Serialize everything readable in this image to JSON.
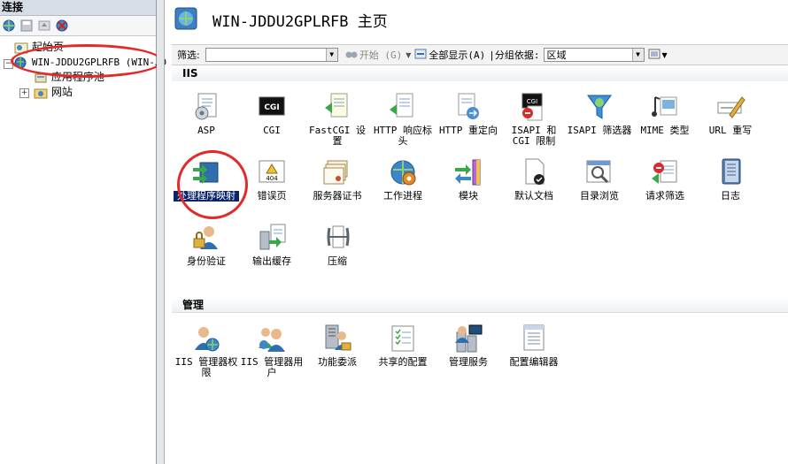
{
  "left_panel": {
    "title": "连接",
    "tree": [
      {
        "label": "起始页"
      },
      {
        "label": "WIN-JDDU2GPLRFB (WIN-JD"
      },
      {
        "label": "应用程序池"
      },
      {
        "label": "网站"
      }
    ]
  },
  "header": {
    "title": "WIN-JDDU2GPLRFB 主页"
  },
  "filter_bar": {
    "filter_label": "筛选:",
    "filter_value": "",
    "start_label": "开始 (G)",
    "show_all_label": "全部显示(A)",
    "group_label": "|分组依据:",
    "group_value": "区域"
  },
  "sections": {
    "iis": {
      "title": "IIS",
      "items": [
        {
          "label": "ASP",
          "icon": "asp-icon"
        },
        {
          "label": "CGI",
          "icon": "cgi-icon"
        },
        {
          "label": "FastCGI 设置",
          "icon": "fastcgi-icon"
        },
        {
          "label": "HTTP 响应标头",
          "icon": "http-headers-icon"
        },
        {
          "label": "HTTP 重定向",
          "icon": "http-redirect-icon"
        },
        {
          "label": "ISAPI 和 CGI 限制",
          "icon": "isapi-cgi-icon"
        },
        {
          "label": "ISAPI 筛选器",
          "icon": "isapi-filter-icon"
        },
        {
          "label": "MIME 类型",
          "icon": "mime-icon"
        },
        {
          "label": "URL 重写",
          "icon": "url-rewrite-icon"
        },
        {
          "label": "处理程序映射",
          "icon": "handler-mapping-icon"
        },
        {
          "label": "错误页",
          "icon": "error-page-icon"
        },
        {
          "label": "服务器证书",
          "icon": "certificate-icon"
        },
        {
          "label": "工作进程",
          "icon": "worker-process-icon"
        },
        {
          "label": "模块",
          "icon": "module-icon"
        },
        {
          "label": "默认文档",
          "icon": "default-document-icon"
        },
        {
          "label": "目录浏览",
          "icon": "directory-browsing-icon"
        },
        {
          "label": "请求筛选",
          "icon": "request-filter-icon"
        },
        {
          "label": "日志",
          "icon": "logging-icon"
        },
        {
          "label": "身份验证",
          "icon": "authentication-icon"
        },
        {
          "label": "输出缓存",
          "icon": "output-cache-icon"
        },
        {
          "label": "压缩",
          "icon": "compression-icon"
        }
      ]
    },
    "management": {
      "title": "管理",
      "items": [
        {
          "label": "IIS 管理器权限",
          "icon": "iis-manager-permissions-icon"
        },
        {
          "label": "IIS 管理器用户",
          "icon": "iis-manager-users-icon"
        },
        {
          "label": "功能委派",
          "icon": "feature-delegation-icon"
        },
        {
          "label": "共享的配置",
          "icon": "shared-config-icon"
        },
        {
          "label": "管理服务",
          "icon": "management-service-icon"
        },
        {
          "label": "配置编辑器",
          "icon": "config-editor-icon"
        }
      ]
    }
  },
  "colors": {
    "selection": "#0a246a",
    "annotation_circle": "#e22a2a",
    "section_header": "#eef1f5"
  }
}
